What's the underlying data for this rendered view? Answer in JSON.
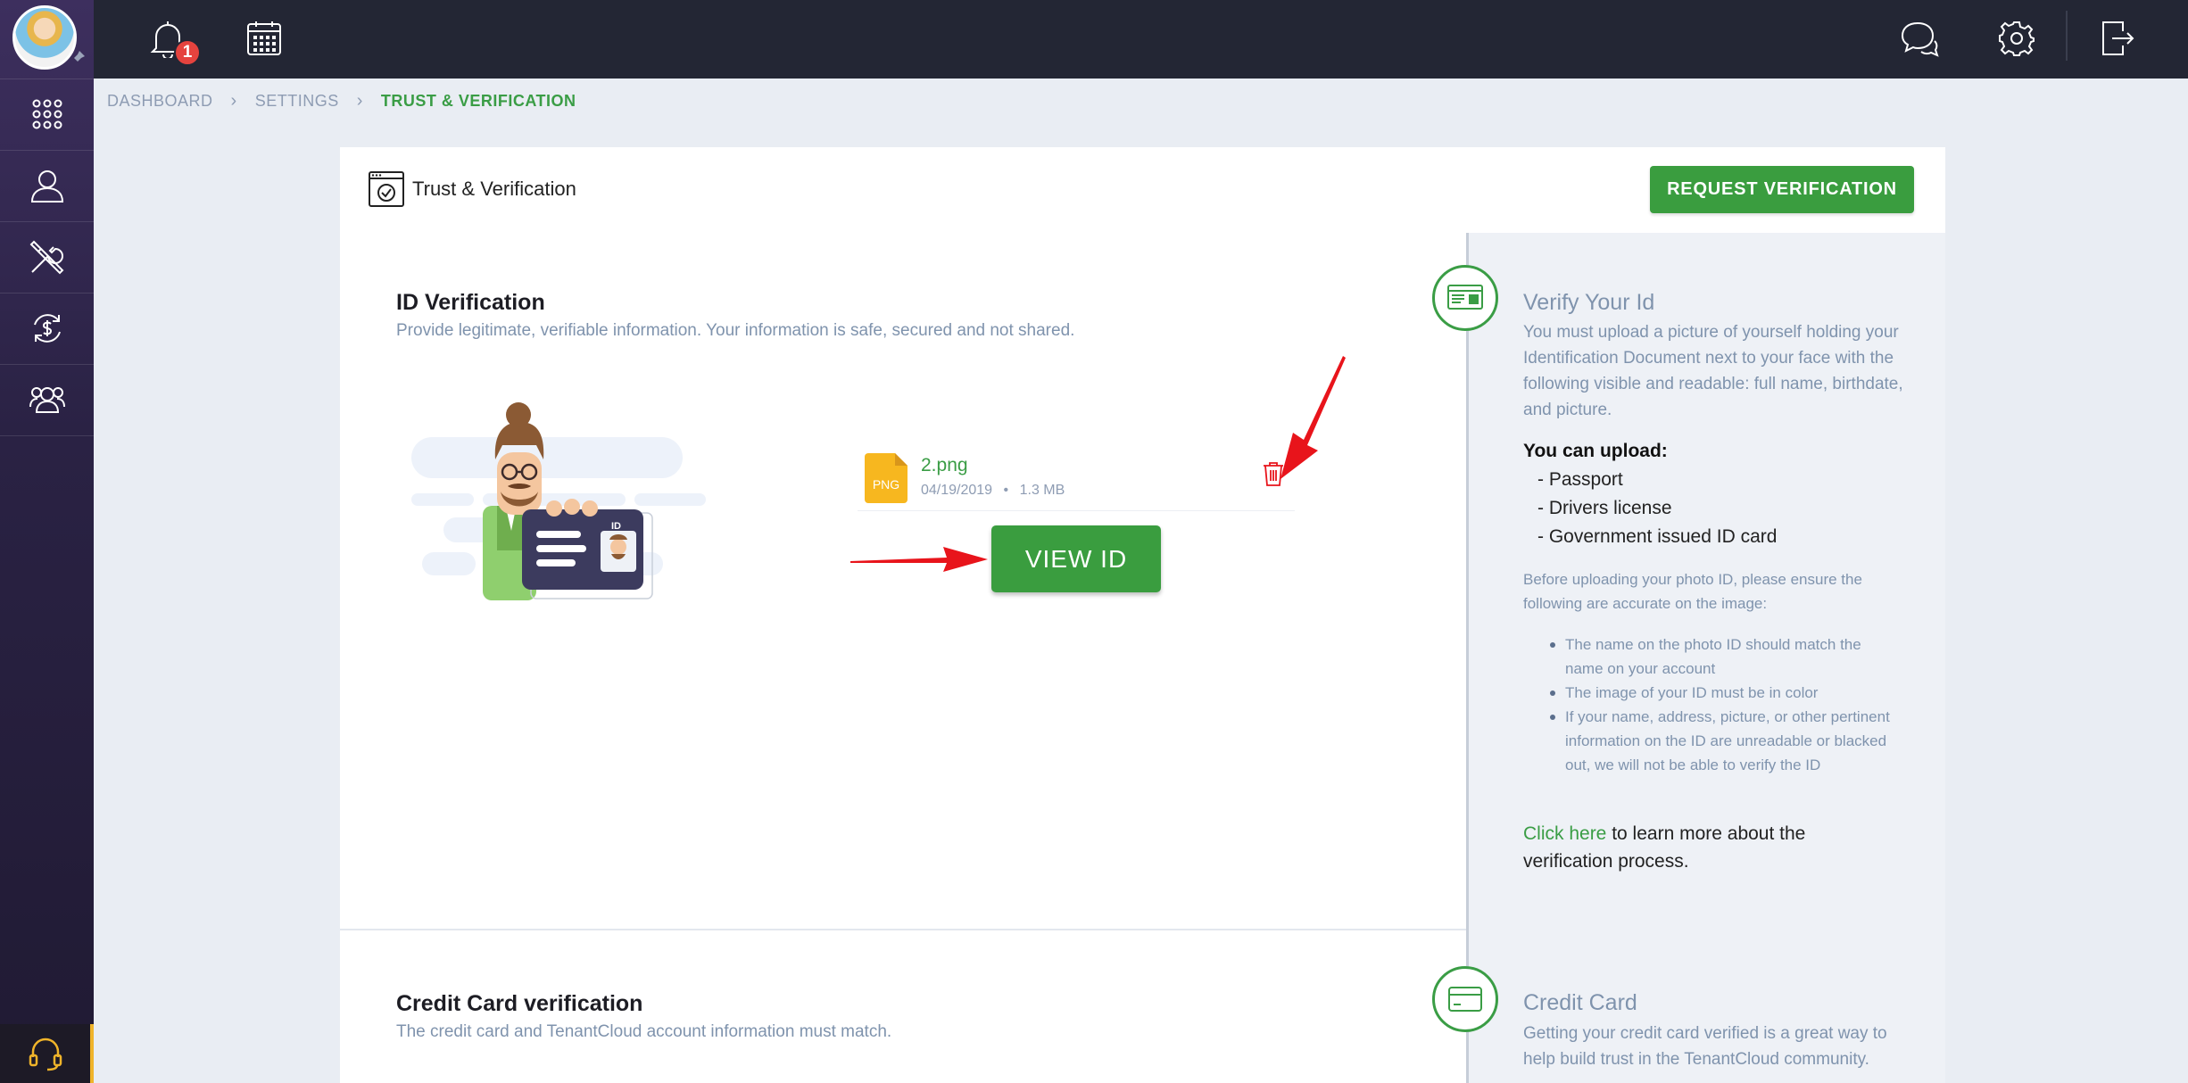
{
  "topbar": {
    "notification_count": "1"
  },
  "breadcrumb": {
    "items": [
      "DASHBOARD",
      "SETTINGS",
      "TRUST & VERIFICATION"
    ]
  },
  "card": {
    "title": "Trust & Verification",
    "request_button": "REQUEST VERIFICATION"
  },
  "id_verification": {
    "title": "ID Verification",
    "subtitle": "Provide legitimate, verifiable information. Your information is safe, secured and not shared.",
    "illustration_label": "ID",
    "file": {
      "type": "PNG",
      "name": "2.png",
      "date": "04/19/2019",
      "size": "1.3 MB"
    },
    "view_button": "VIEW ID"
  },
  "verify_panel": {
    "title": "Verify Your Id",
    "description": "You must upload a picture of yourself holding your Identification Document next to your face with the following visible and readable: full name, birthdate, and picture.",
    "upload_heading": "You can upload:",
    "upload_items": [
      "- Passport",
      "- Drivers license",
      "- Government issued ID card"
    ],
    "ensure_text": "Before uploading your photo ID, please ensure the following are accurate on the image:",
    "bullets": [
      "The name on the photo ID should match the name on your account",
      "The image of your ID must be in color",
      "If your name, address, picture, or other pertinent information on the ID are unreadable or blacked out, we will not be able to verify the ID"
    ],
    "link_label": "Click here",
    "link_suffix": " to learn more about the verification process."
  },
  "credit_card": {
    "title": "Credit Card verification",
    "subtitle": "The credit card and TenantCloud account information must match.",
    "panel_title": "Credit Card",
    "panel_text": "Getting your credit card verified is a great way to help build trust in the TenantCloud community."
  },
  "colors": {
    "accent_green": "#3a9d3f",
    "sidebar": "#2a2244",
    "topbar": "#232634",
    "annotation_red": "#e8141b"
  }
}
